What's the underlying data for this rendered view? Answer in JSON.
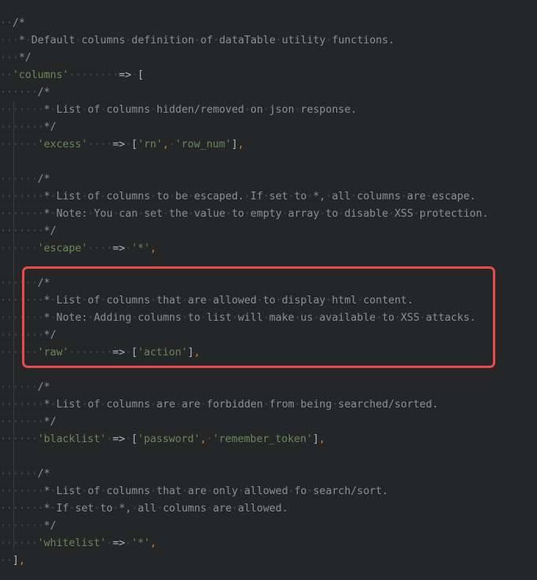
{
  "editor": {
    "language": "php",
    "highlight_color": "#e84a4a",
    "lines": [
      {
        "indent": 1,
        "tokens": [
          {
            "t": "comment",
            "v": "/*"
          }
        ]
      },
      {
        "indent": 1,
        "tokens": [
          {
            "t": "comment",
            "v": " * Default columns definition of dataTable utility functions."
          }
        ]
      },
      {
        "indent": 1,
        "tokens": [
          {
            "t": "comment",
            "v": " */"
          }
        ]
      },
      {
        "indent": 1,
        "tokens": [
          {
            "t": "str",
            "v": "'columns'"
          },
          {
            "t": "ws",
            "v": "        "
          },
          {
            "t": "op",
            "v": "=>"
          },
          {
            "t": "ws",
            "v": " "
          },
          {
            "t": "bracket",
            "v": "["
          }
        ]
      },
      {
        "indent": 3,
        "tokens": [
          {
            "t": "comment",
            "v": "/*"
          }
        ]
      },
      {
        "indent": 3,
        "tokens": [
          {
            "t": "comment",
            "v": " * List of columns hidden/removed on json response."
          }
        ]
      },
      {
        "indent": 3,
        "tokens": [
          {
            "t": "comment",
            "v": " */"
          }
        ]
      },
      {
        "indent": 3,
        "tokens": [
          {
            "t": "str",
            "v": "'excess'"
          },
          {
            "t": "ws",
            "v": "    "
          },
          {
            "t": "op",
            "v": "=>"
          },
          {
            "t": "ws",
            "v": " "
          },
          {
            "t": "bracket",
            "v": "["
          },
          {
            "t": "str",
            "v": "'rn'"
          },
          {
            "t": "comma",
            "v": ","
          },
          {
            "t": "ws",
            "v": " "
          },
          {
            "t": "str",
            "v": "'row_num'"
          },
          {
            "t": "bracket",
            "v": "]"
          },
          {
            "t": "comma",
            "v": ","
          }
        ]
      },
      {
        "indent": 0,
        "tokens": []
      },
      {
        "indent": 3,
        "tokens": [
          {
            "t": "comment",
            "v": "/*"
          }
        ]
      },
      {
        "indent": 3,
        "tokens": [
          {
            "t": "comment",
            "v": " * List of columns to be escaped. If set to *, all columns are escape."
          }
        ]
      },
      {
        "indent": 3,
        "tokens": [
          {
            "t": "comment",
            "v": " * Note: You can set the value to empty array to disable XSS protection."
          }
        ]
      },
      {
        "indent": 3,
        "tokens": [
          {
            "t": "comment",
            "v": " */"
          }
        ]
      },
      {
        "indent": 3,
        "tokens": [
          {
            "t": "str",
            "v": "'escape'"
          },
          {
            "t": "ws",
            "v": "    "
          },
          {
            "t": "op",
            "v": "=>"
          },
          {
            "t": "ws",
            "v": " "
          },
          {
            "t": "str",
            "v": "'*'"
          },
          {
            "t": "comma",
            "v": ","
          }
        ]
      },
      {
        "indent": 0,
        "tokens": []
      },
      {
        "indent": 3,
        "tokens": [
          {
            "t": "comment",
            "v": "/*"
          }
        ]
      },
      {
        "indent": 3,
        "tokens": [
          {
            "t": "comment",
            "v": " * List of columns that are allowed to display html content."
          }
        ]
      },
      {
        "indent": 3,
        "tokens": [
          {
            "t": "comment",
            "v": " * Note: Adding columns to list will make us available to XSS attacks."
          }
        ]
      },
      {
        "indent": 3,
        "tokens": [
          {
            "t": "comment",
            "v": " */"
          }
        ]
      },
      {
        "indent": 3,
        "tokens": [
          {
            "t": "str",
            "v": "'raw'"
          },
          {
            "t": "ws",
            "v": "       "
          },
          {
            "t": "op",
            "v": "=>"
          },
          {
            "t": "ws",
            "v": " "
          },
          {
            "t": "bracket",
            "v": "["
          },
          {
            "t": "str",
            "v": "'action'"
          },
          {
            "t": "bracket",
            "v": "]"
          },
          {
            "t": "comma",
            "v": ","
          }
        ]
      },
      {
        "indent": 0,
        "tokens": []
      },
      {
        "indent": 3,
        "tokens": [
          {
            "t": "comment",
            "v": "/*"
          }
        ]
      },
      {
        "indent": 3,
        "tokens": [
          {
            "t": "comment",
            "v": " * List of columns are are forbidden from being searched/sorted."
          }
        ]
      },
      {
        "indent": 3,
        "tokens": [
          {
            "t": "comment",
            "v": " */"
          }
        ]
      },
      {
        "indent": 3,
        "tokens": [
          {
            "t": "str",
            "v": "'blacklist'"
          },
          {
            "t": "ws",
            "v": " "
          },
          {
            "t": "op",
            "v": "=>"
          },
          {
            "t": "ws",
            "v": " "
          },
          {
            "t": "bracket",
            "v": "["
          },
          {
            "t": "str",
            "v": "'password'"
          },
          {
            "t": "comma",
            "v": ","
          },
          {
            "t": "ws",
            "v": " "
          },
          {
            "t": "str",
            "v": "'remember_token'"
          },
          {
            "t": "bracket",
            "v": "]"
          },
          {
            "t": "comma",
            "v": ","
          }
        ]
      },
      {
        "indent": 0,
        "tokens": []
      },
      {
        "indent": 3,
        "tokens": [
          {
            "t": "comment",
            "v": "/*"
          }
        ]
      },
      {
        "indent": 3,
        "tokens": [
          {
            "t": "comment",
            "v": " * List of columns that are only allowed fo search/sort."
          }
        ]
      },
      {
        "indent": 3,
        "tokens": [
          {
            "t": "comment",
            "v": " * If set to *, all columns are allowed."
          }
        ]
      },
      {
        "indent": 3,
        "tokens": [
          {
            "t": "comment",
            "v": " */"
          }
        ]
      },
      {
        "indent": 3,
        "tokens": [
          {
            "t": "str",
            "v": "'whitelist'"
          },
          {
            "t": "ws",
            "v": " "
          },
          {
            "t": "op",
            "v": "=>"
          },
          {
            "t": "ws",
            "v": " "
          },
          {
            "t": "str",
            "v": "'*'"
          },
          {
            "t": "comma",
            "v": ","
          }
        ]
      },
      {
        "indent": 1,
        "tokens": [
          {
            "t": "bracket",
            "v": "]"
          },
          {
            "t": "comma",
            "v": ","
          }
        ]
      }
    ]
  }
}
